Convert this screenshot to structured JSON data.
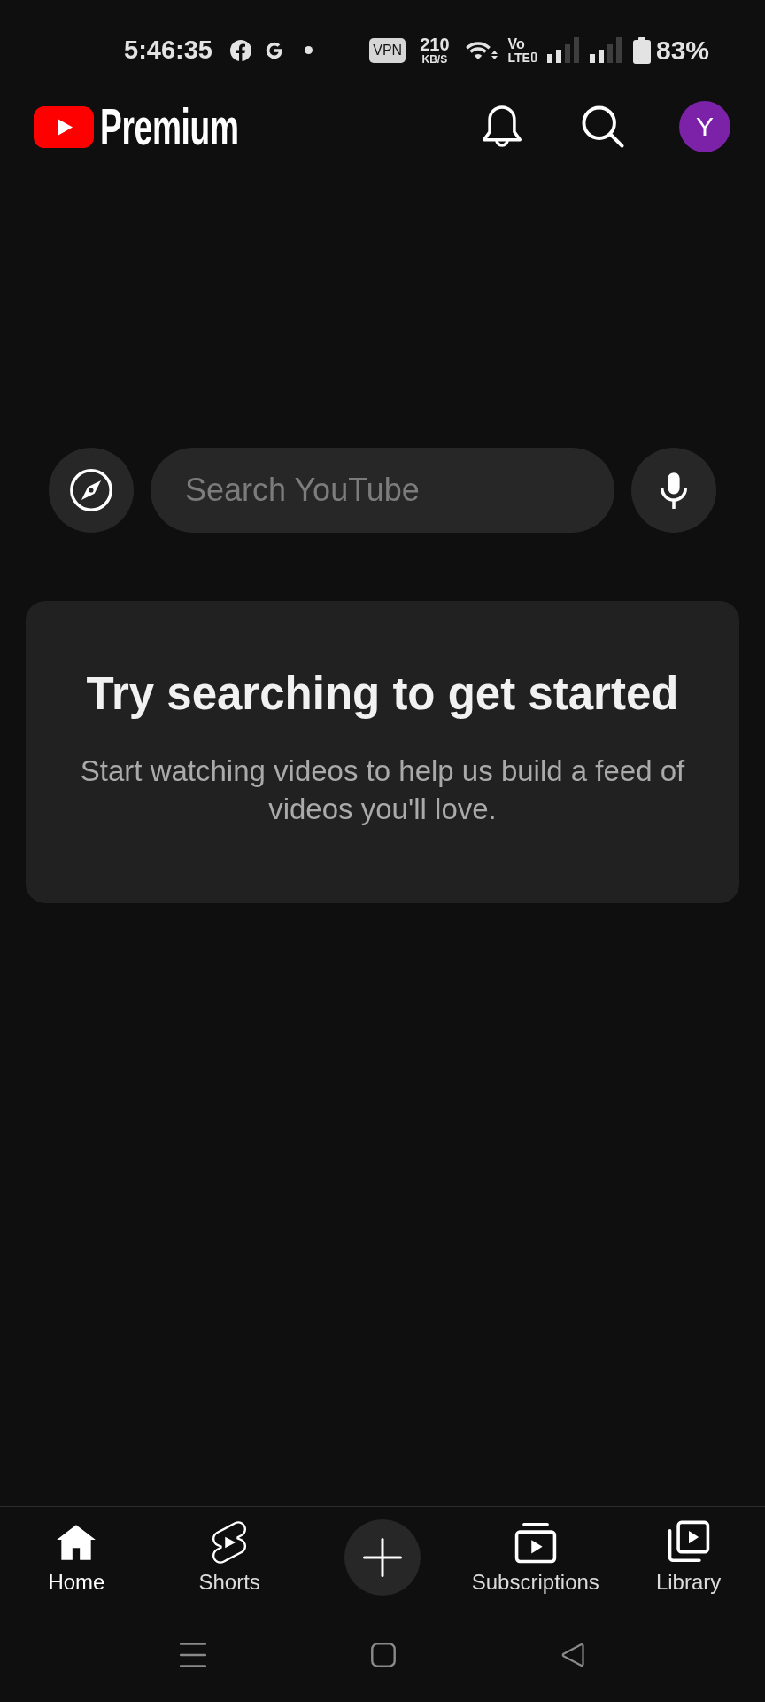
{
  "status_bar": {
    "time": "5:46:35",
    "vpn": "VPN",
    "speed": "210",
    "speed_unit": "KB/S",
    "volte_top": "Vo",
    "volte_bottom": "LTE",
    "battery": "83%"
  },
  "header": {
    "brand": "Premium",
    "avatar_letter": "Y"
  },
  "search": {
    "placeholder": "Search YouTube"
  },
  "empty_state": {
    "title": "Try searching to get started",
    "message": "Start watching videos to help us build a feed of videos you'll love."
  },
  "bottom_nav": [
    {
      "kind": "tab",
      "label": "Home",
      "selected": true
    },
    {
      "kind": "tab",
      "label": "Shorts",
      "selected": false
    },
    {
      "kind": "create"
    },
    {
      "kind": "tab",
      "label": "Subscriptions",
      "selected": false
    },
    {
      "kind": "tab",
      "label": "Library",
      "selected": false
    }
  ]
}
